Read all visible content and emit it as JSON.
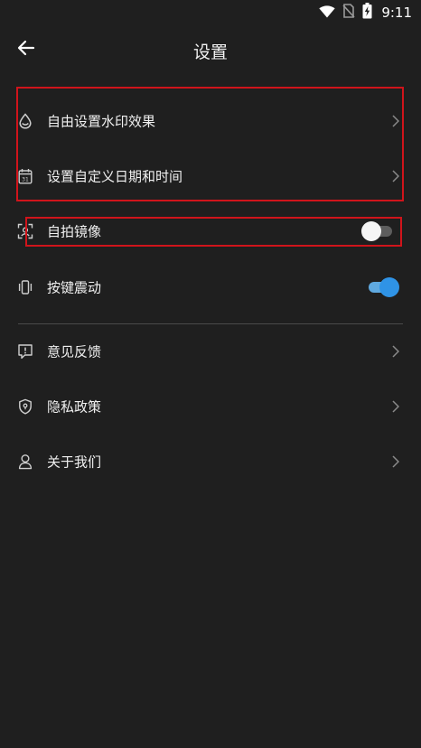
{
  "status_bar": {
    "time": "9:11",
    "icons": [
      "wifi-icon",
      "no-sim-icon",
      "battery-charging-icon"
    ]
  },
  "header": {
    "title": "设置",
    "back_icon": "arrow-left-icon"
  },
  "settings": {
    "watermark": {
      "label": "自由设置水印效果",
      "icon": "water-drop-icon"
    },
    "custom_datetime": {
      "label": "设置自定义日期和时间",
      "icon": "calendar-icon"
    },
    "selfie_mirror": {
      "label": "自拍镜像",
      "icon": "selfie-frame-icon",
      "enabled": false
    },
    "key_vibration": {
      "label": "按键震动",
      "icon": "vibration-icon",
      "enabled": true
    },
    "feedback": {
      "label": "意见反馈",
      "icon": "feedback-icon"
    },
    "privacy": {
      "label": "隐私政策",
      "icon": "shield-icon"
    },
    "about": {
      "label": "关于我们",
      "icon": "user-icon"
    }
  },
  "colors": {
    "background": "#1f1f1f",
    "highlight_border": "#d0141b",
    "toggle_on": "#2f93e6",
    "toggle_off_track": "#5d5d5d"
  }
}
